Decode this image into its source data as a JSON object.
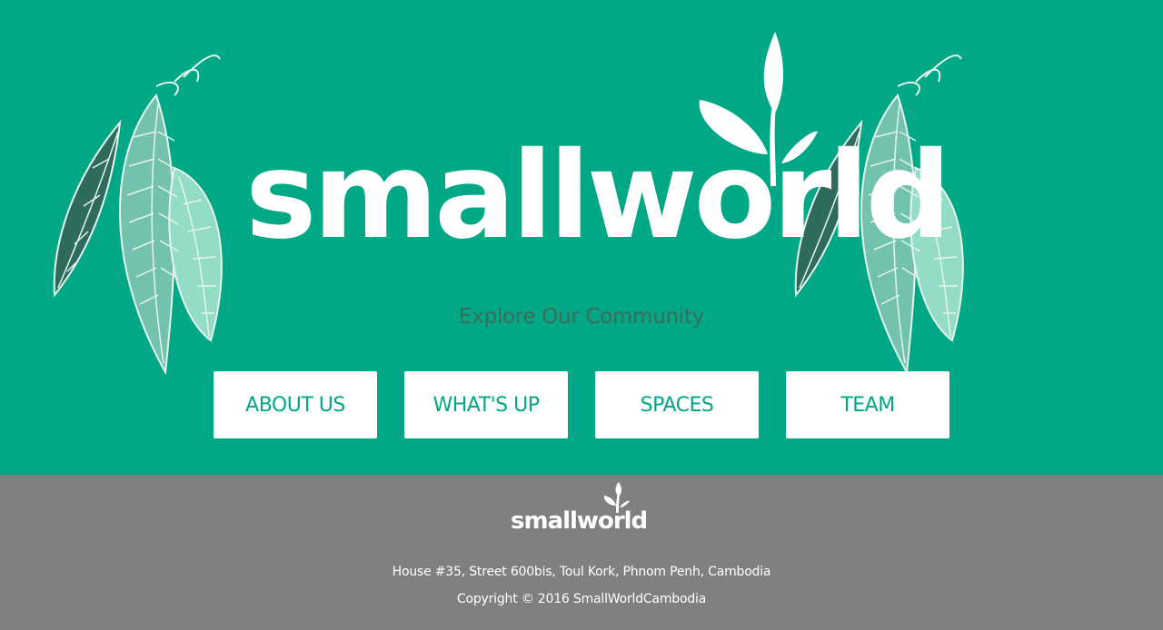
{
  "brand": {
    "name": "smallworld",
    "accent": "#00a886",
    "footer_bg": "#808080"
  },
  "hero": {
    "tagline": "Explore Our Community"
  },
  "nav": {
    "items": [
      {
        "label": "ABOUT US"
      },
      {
        "label": "WHAT'S UP"
      },
      {
        "label": "SPACES"
      },
      {
        "label": "TEAM"
      }
    ]
  },
  "footer": {
    "logo_text": "smallworld",
    "address": "House #35, Street 600bis, Toul Kork, Phnom Penh, Cambodia",
    "copyright": "Copyright © 2016 SmallWorldCambodia"
  },
  "icons": [
    "leaf-cluster-icon",
    "sprout-icon",
    "globe-icon"
  ]
}
